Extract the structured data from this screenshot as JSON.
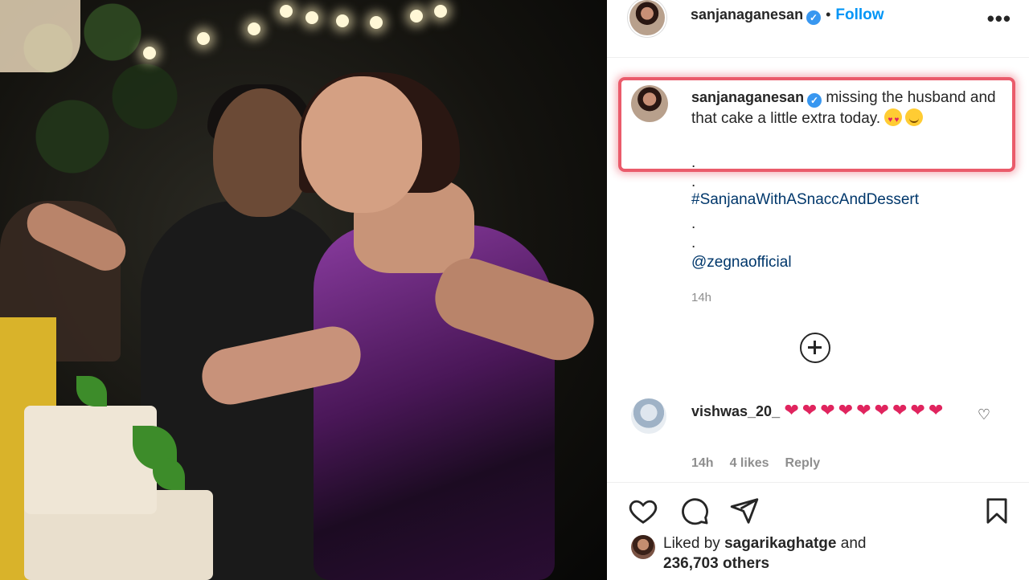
{
  "post": {
    "author": "sanjanaganesan",
    "follow_label": "Follow",
    "separator": "•",
    "more_label": "•••"
  },
  "caption": {
    "author": "sanjanaganesan",
    "text": "missing the husband and that cake a little extra today.",
    "emojis": [
      "heart-eyes-emoji",
      "smile-emoji"
    ],
    "dot1": ".",
    "dot2": ".",
    "hashtag": "#SanjanaWithASnaccAndDessert",
    "dot3": ".",
    "dot4": ".",
    "mention": "@zegnaofficial",
    "timestamp": "14h"
  },
  "comment": {
    "user": "vishwas_20_",
    "text": "❤❤❤❤❤❤❤❤❤",
    "timestamp": "14h",
    "likes": "4 likes",
    "reply_label": "Reply"
  },
  "likes": {
    "prefix": "Liked by",
    "user": "sagarikaghatge",
    "and": "and",
    "others": "236,703 others"
  },
  "colors": {
    "accent": "#0095f6",
    "highlight_border": "#ea5b6b",
    "heart": "#e0245e",
    "verified": "#3897f0"
  }
}
